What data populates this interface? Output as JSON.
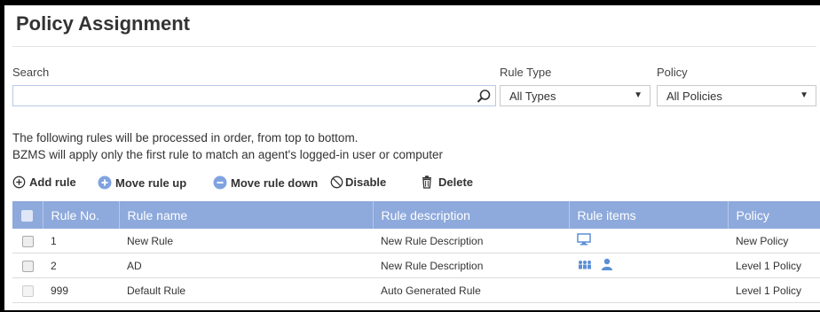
{
  "page": {
    "title": "Policy Assignment"
  },
  "filters": {
    "search_label": "Search",
    "search_value": "",
    "rule_type_label": "Rule Type",
    "rule_type_value": "All Types",
    "policy_label": "Policy",
    "policy_value": "All Policies"
  },
  "info": {
    "line1": "The following rules will be processed in order, from top to bottom.",
    "line2": "BZMS will apply only the first rule to match an agent's logged-in user or computer"
  },
  "toolbar": {
    "add_rule": "Add rule",
    "move_up": "Move rule up",
    "move_down": "Move rule down",
    "disable": "Disable",
    "delete": "Delete"
  },
  "table": {
    "headers": [
      "Rule No.",
      "Rule name",
      "Rule description",
      "Rule items",
      "Policy"
    ],
    "rows": [
      {
        "no": "1",
        "name": "New Rule",
        "description": "New Rule Description",
        "items": [
          "computer-icon"
        ],
        "policy": "New Policy"
      },
      {
        "no": "2",
        "name": "AD",
        "description": "New Rule Description",
        "items": [
          "group-icon",
          "user-icon"
        ],
        "policy": "Level 1 Policy"
      },
      {
        "no": "999",
        "name": "Default Rule",
        "description": "Auto Generated Rule",
        "items": [],
        "policy": "Level 1 Policy"
      }
    ]
  },
  "colors": {
    "header_bg": "#8ea9db",
    "accent": "#5b8fd6"
  }
}
